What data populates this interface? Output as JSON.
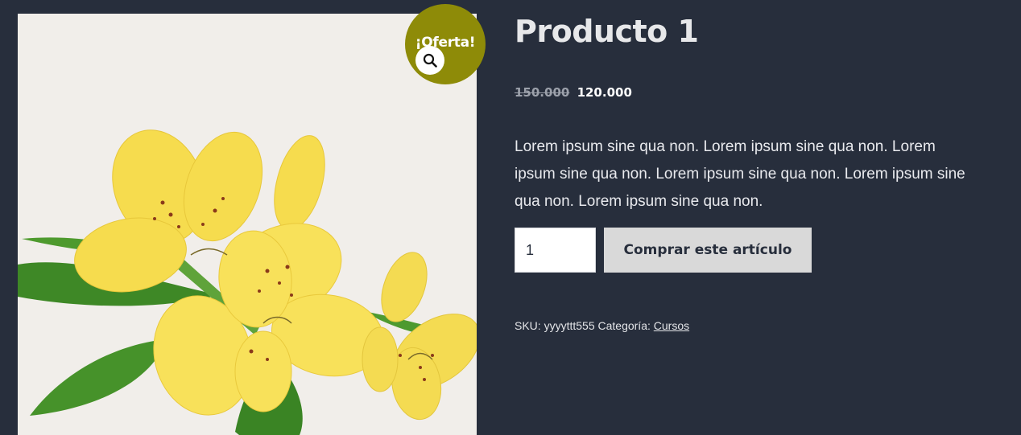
{
  "product": {
    "title": "Producto 1",
    "sale_badge": "¡Oferta!",
    "image_alt": "Flores amarillas",
    "zoom_icon": "search-icon",
    "price": {
      "regular": "150.000",
      "sale": "120.000"
    },
    "description": "Lorem ipsum sine qua non. Lorem ipsum sine qua non. Lorem ipsum sine qua non. Lorem ipsum sine qua non. Lorem ipsum sine qua non. Lorem ipsum sine qua non.",
    "cart": {
      "quantity": "1",
      "button_label": "Comprar este artículo"
    },
    "meta": {
      "sku_label": "SKU:",
      "sku_value": "yyyyttt555",
      "category_label": "Categoría:",
      "category_value": "Cursos"
    }
  },
  "colors": {
    "background": "#272e3c",
    "badge": "#8e8b08",
    "button": "#d9d9d9",
    "petal": "#f7df4a",
    "leaf": "#3f8a25"
  }
}
